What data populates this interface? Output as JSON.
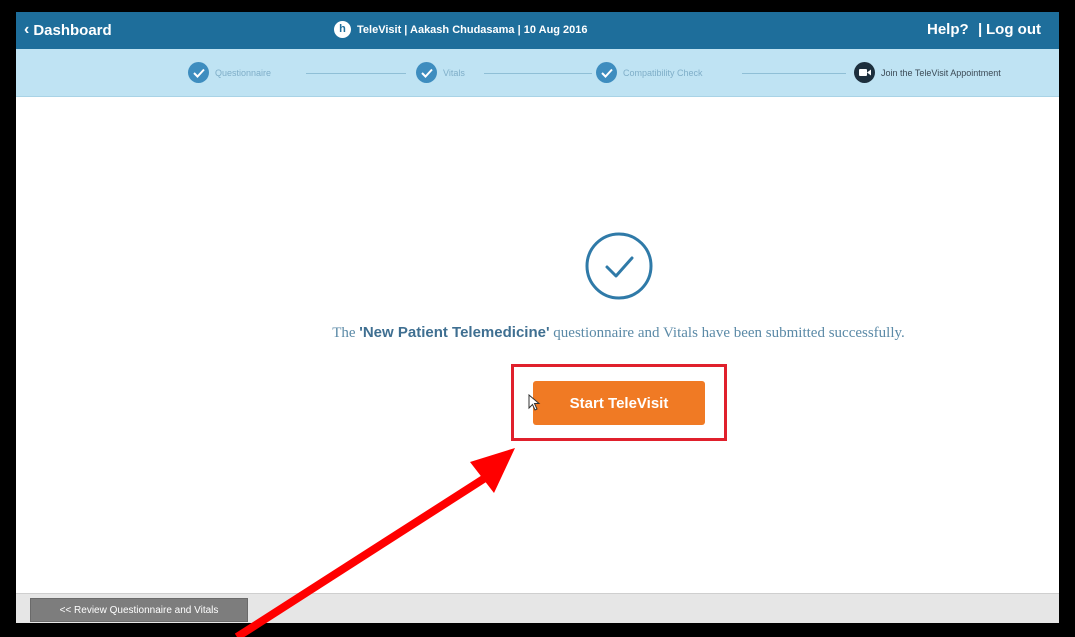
{
  "topbar": {
    "back_label": "Dashboard",
    "title": "TeleVisit | Aakash Chudasama | 10 Aug 2016",
    "help_label": "Help?",
    "separator": "|",
    "logout_label": "Log out",
    "background_color": "#1e6e9b"
  },
  "steps": [
    {
      "label": "Questionnaire",
      "status": "done"
    },
    {
      "label": "Vitals",
      "status": "done"
    },
    {
      "label": "Compatibility Check",
      "status": "done"
    },
    {
      "label": "Join the TeleVisit Appointment",
      "status": "current"
    }
  ],
  "main": {
    "message_prefix": "The ",
    "questionnaire_name": "'New Patient Telemedicine'",
    "message_suffix": " questionnaire and Vitals have been submitted successfully.",
    "start_button_label": "Start TeleVisit",
    "start_button_color": "#f07a24"
  },
  "footer": {
    "review_button_label": "<< Review Questionnaire and Vitals"
  },
  "annotation": {
    "highlight_color": "#e0202c",
    "arrow_color": "#ff0000"
  }
}
